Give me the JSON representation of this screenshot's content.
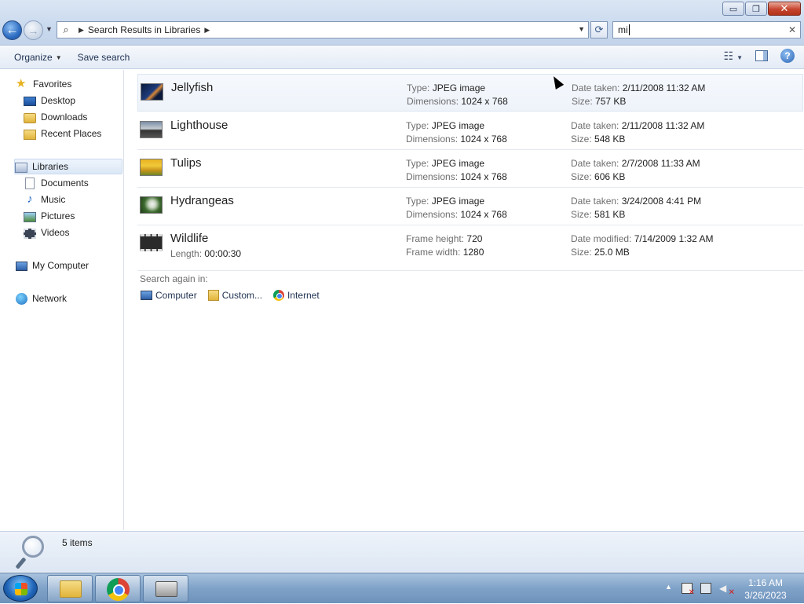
{
  "window": {
    "minimize_glyph": "▭",
    "restore_glyph": "❐",
    "close_glyph": "✕"
  },
  "nav": {
    "back_glyph": "←",
    "forward_glyph": "→",
    "address_icon": "magnifier-icon",
    "address_text": "Search Results in Libraries",
    "search_value": "mi"
  },
  "toolbar": {
    "organize_label": "Organize",
    "save_search_label": "Save search"
  },
  "sidebar": {
    "favorites": "Favorites",
    "desktop": "Desktop",
    "downloads": "Downloads",
    "recent_places": "Recent Places",
    "libraries": "Libraries",
    "documents": "Documents",
    "music": "Music",
    "pictures": "Pictures",
    "videos": "Videos",
    "my_computer": "My Computer",
    "network": "Network"
  },
  "results": [
    {
      "name": "Jellyfish",
      "p1_key": "Type:",
      "p1_val": "JPEG image",
      "p2_key": "Dimensions:",
      "p2_val": "1024 x 768",
      "p3_key": "Date taken:",
      "p3_val": "2/11/2008 11:32 AM",
      "p4_key": "Size:",
      "p4_val": "757 KB"
    },
    {
      "name": "Lighthouse",
      "p1_key": "Type:",
      "p1_val": "JPEG image",
      "p2_key": "Dimensions:",
      "p2_val": "1024 x 768",
      "p3_key": "Date taken:",
      "p3_val": "2/11/2008 11:32 AM",
      "p4_key": "Size:",
      "p4_val": "548 KB"
    },
    {
      "name": "Tulips",
      "p1_key": "Type:",
      "p1_val": "JPEG image",
      "p2_key": "Dimensions:",
      "p2_val": "1024 x 768",
      "p3_key": "Date taken:",
      "p3_val": "2/7/2008 11:33 AM",
      "p4_key": "Size:",
      "p4_val": "606 KB"
    },
    {
      "name": "Hydrangeas",
      "p1_key": "Type:",
      "p1_val": "JPEG image",
      "p2_key": "Dimensions:",
      "p2_val": "1024 x 768",
      "p3_key": "Date taken:",
      "p3_val": "3/24/2008 4:41 PM",
      "p4_key": "Size:",
      "p4_val": "581 KB"
    },
    {
      "name": "Wildlife",
      "sub_key": "Length:",
      "sub_val": "00:00:30",
      "p1_key": "Frame height:",
      "p1_val": "720",
      "p2_key": "Frame width:",
      "p2_val": "1280",
      "p3_key": "Date modified:",
      "p3_val": "7/14/2009 1:32 AM",
      "p4_key": "Size:",
      "p4_val": "25.0 MB"
    }
  ],
  "search_again": {
    "label": "Search again in:",
    "computer": "Computer",
    "custom": "Custom...",
    "internet": "Internet"
  },
  "status": {
    "items": "5 items"
  },
  "taskbar": {
    "time": "1:16 AM",
    "date": "3/26/2023"
  }
}
